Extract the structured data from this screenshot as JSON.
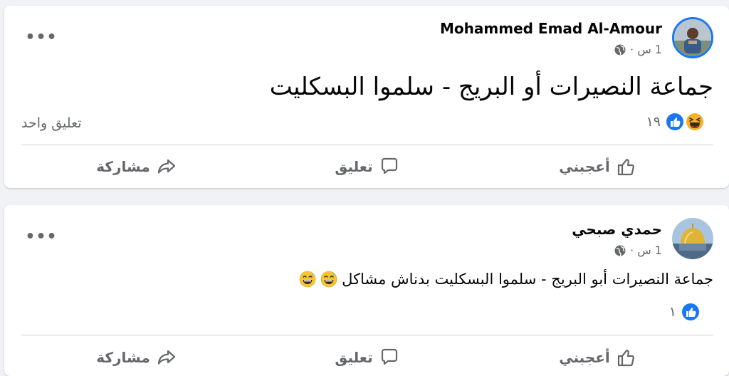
{
  "posts": [
    {
      "author": "Mohammed Emad Al-Amour",
      "time": "1 س ·",
      "text": "جماعة النصيرات أو البريج - سلموا البسكليت",
      "reaction_count": "١٩",
      "comment_count": "تعليق واحد",
      "reactions": [
        "laugh-react-icon",
        "like-react-icon"
      ]
    },
    {
      "author": "حمدي صبحي",
      "time": "1 س ·",
      "text": "جماعة النصيرات أبو البريج - سلموا البسكليت  بدناش مشاكل",
      "reaction_count": "١",
      "reactions": [
        "like-react-icon"
      ]
    }
  ],
  "actions": {
    "like": "أعجبني",
    "comment": "تعليق",
    "share": "مشاركة"
  },
  "colors": {
    "page_bg": "#f0f2f5",
    "card_bg": "#ffffff",
    "secondary_text": "#65676b",
    "like_blue": "#1877f2",
    "avatar_ring": "#1877f2"
  }
}
